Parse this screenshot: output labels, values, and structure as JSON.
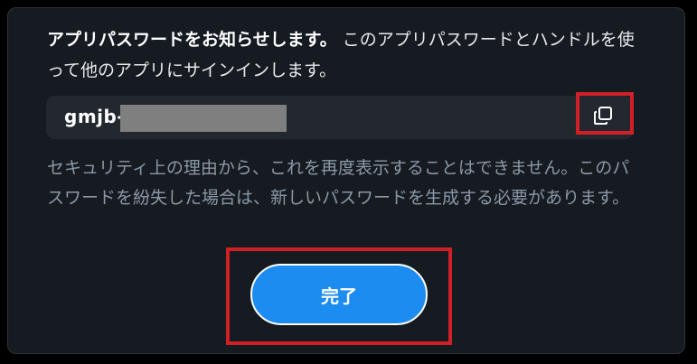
{
  "dialog": {
    "intro_title": "アプリパスワードをお知らせします。",
    "intro_body": "このアプリパスワードとハンドルを使って他のアプリにサインインします。",
    "password_prefix": "gmjb-",
    "copy_icon": "copy-icon",
    "warning": "セキュリティ上の理由から、これを再度表示することはできません。このパスワードを紛失した場合は、新しいパスワードを生成する必要があります。",
    "done_label": "完了"
  },
  "colors": {
    "background": "#161b22",
    "field": "#22282e",
    "accent": "#1d8cf0",
    "highlight": "#d01f26",
    "muted_text": "#8b98a5"
  }
}
